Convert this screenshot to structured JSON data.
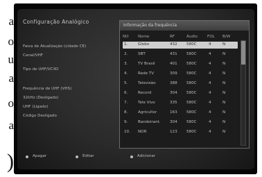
{
  "side_text": [
    "a",
    "o",
    "u",
    "a",
    "o",
    "a",
    ")"
  ],
  "screen": {
    "title": "Configuração Analógico",
    "menu": [
      "Faixa de Atualização (cidade CE)",
      "Canal/VHF",
      "Tipo de UHF/VCXO",
      "Frequência de UHF (VHS)",
      "32kHz (Desligado)",
      "UHF (Ligado)",
      "Código Desligado"
    ]
  },
  "panel": {
    "title": "Informação da frequência",
    "headers": [
      "NO",
      "Nome",
      "RF",
      "Áudio",
      "FOL",
      "B/W"
    ],
    "rows": [
      [
        "1.",
        "Globo",
        "432",
        "580C",
        "4",
        "N"
      ],
      [
        "2.",
        "SBT",
        "431",
        "580C",
        "4",
        "N"
      ],
      [
        "3.",
        "TV Brasil",
        "401",
        "580C",
        "4",
        "N"
      ],
      [
        "4.",
        "Rede TV",
        "309",
        "580C",
        "4",
        "N"
      ],
      [
        "5.",
        "Televisão",
        "388",
        "580C",
        "4",
        "N"
      ],
      [
        "6.",
        "Record",
        "304",
        "580C",
        "4",
        "N"
      ],
      [
        "7.",
        "Tele Vivo",
        "335",
        "580C",
        "4",
        "N"
      ],
      [
        "8.",
        "Agricultor",
        "163",
        "580C",
        "4",
        "N"
      ],
      [
        "9.",
        "Bandeirant.",
        "304",
        "580C",
        "4",
        "N"
      ],
      [
        "10.",
        "NOR",
        "123",
        "580C",
        "4",
        "N"
      ]
    ]
  },
  "bottom_bar": {
    "delete_label": "Apagar",
    "edit_label": "Editar",
    "add_label": "Adicionar"
  },
  "colors": {
    "screen_bg": "#2e2e2e",
    "selected_row": "#cfcfcf",
    "text": "#bdbdbd"
  }
}
